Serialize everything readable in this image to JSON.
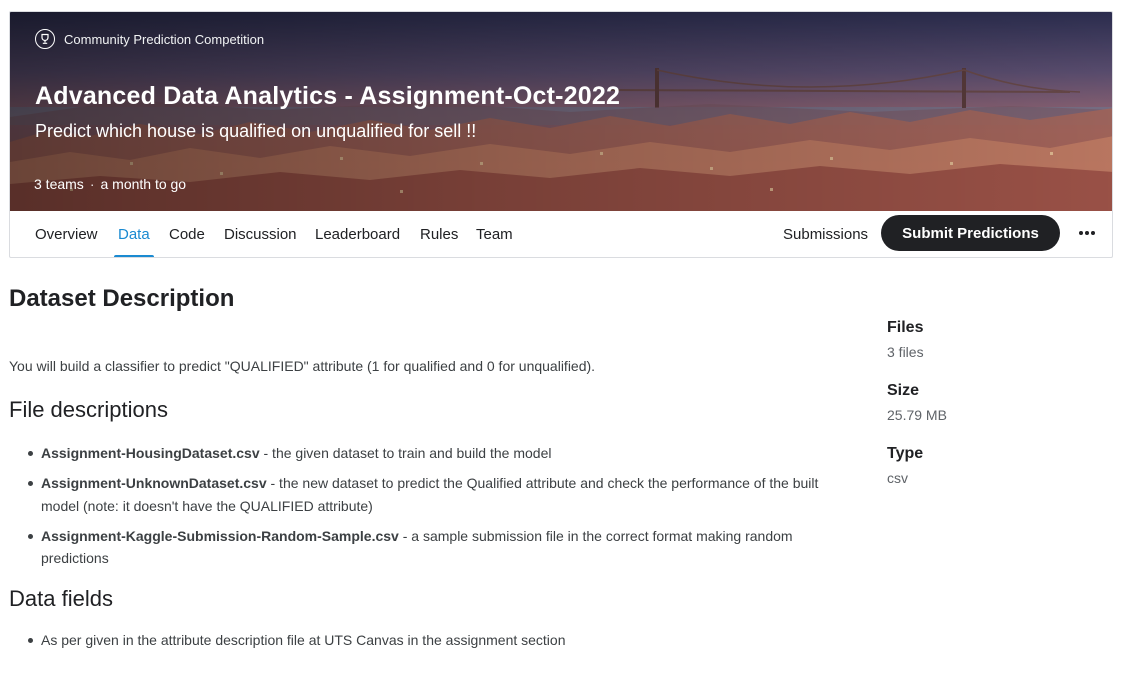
{
  "header": {
    "competition_type": "Community Prediction Competition",
    "title": "Advanced Data Analytics - Assignment-Oct-2022",
    "subtitle": "Predict which house is qualified on unqualified for sell !!",
    "teams": "3 teams",
    "separator": "·",
    "deadline": "a month to go",
    "trophy_icon": "trophy-icon"
  },
  "tabs": [
    {
      "label": "Overview"
    },
    {
      "label": "Data",
      "active": true
    },
    {
      "label": "Code"
    },
    {
      "label": "Discussion"
    },
    {
      "label": "Leaderboard"
    },
    {
      "label": "Rules"
    },
    {
      "label": "Team"
    }
  ],
  "actions": {
    "submissions_label": "Submissions",
    "submit_label": "Submit Predictions",
    "more_icon": "more-horizontal-icon"
  },
  "content": {
    "heading": "Dataset Description",
    "intro": "You will build a classifier to predict \"QUALIFIED\" attribute (1 for qualified and 0 for unqualified).",
    "file_descriptions_heading": "File descriptions",
    "files": [
      {
        "name": "Assignment-HousingDataset.csv",
        "description": " - the given dataset to train and build the model"
      },
      {
        "name": "Assignment-UnknownDataset.csv",
        "description": " - the new dataset to predict the Qualified attribute and check the performance of the built model (note: it doesn't have the QUALIFIED attribute)"
      },
      {
        "name": "Assignment-Kaggle-Submission-Random-Sample.csv",
        "description": " - a sample submission file in the correct format making random predictions"
      }
    ],
    "data_fields_heading": "Data fields",
    "data_fields": [
      "As per given in the attribute description file at UTS Canvas in the assignment section"
    ]
  },
  "sidebar": {
    "files_label": "Files",
    "files_value": "3 files",
    "size_label": "Size",
    "size_value": "25.79 MB",
    "type_label": "Type",
    "type_value": "csv"
  },
  "colors": {
    "accent": "#1a8ad1",
    "primary_button": "#202124",
    "text": "#202124",
    "muted": "#5f6368"
  }
}
